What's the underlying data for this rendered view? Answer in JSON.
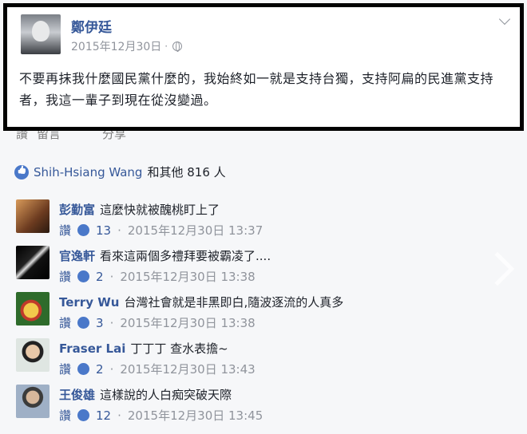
{
  "post": {
    "author": "鄭伊廷",
    "date": "2015年12月30日",
    "separator": "·",
    "body": "不要再抹我什麼國民黨什麼的，我始終如一就是支持台獨，支持阿扁的民進黨支持者，我這一輩子到現在從沒變過。"
  },
  "actions": {
    "like": "讚",
    "comment": "留言",
    "share": "分享"
  },
  "reactions": {
    "names": "Shih-Hsiang Wang",
    "others": "和其他 816 人"
  },
  "comments": [
    {
      "name": "彭勤富",
      "text": "這麼快就被醜桃盯上了",
      "reply": "讚",
      "likes": "13",
      "timestamp": "2015年12月30日 13:37",
      "avatar_color": "#6b3a1f"
    },
    {
      "name": "官逸軒",
      "text": "看來這兩個多禮拜要被霸凌了....",
      "reply": "讚",
      "likes": "2",
      "timestamp": "2015年12月30日 13:38",
      "avatar_color": "#111111"
    },
    {
      "name": "Terry Wu",
      "text": "台灣社會就是非黑即白,隨波逐流的人真多",
      "reply": "讚",
      "likes": "3",
      "timestamp": "2015年12月30日 13:38",
      "avatar_color": "#2e6b2b"
    },
    {
      "name": "Fraser Lai",
      "text": "丁丁丁 查水表擔~",
      "reply": "讚",
      "likes": "2",
      "timestamp": "2015年12月30日 13:43",
      "avatar_color": "#3d4a44"
    },
    {
      "name": "王俊雄",
      "text": "這樣說的人白痴突破天際",
      "reply": "讚",
      "likes": "12",
      "timestamp": "2015年12月30日 13:45",
      "avatar_color": "#5b6d86"
    }
  ],
  "icons": {
    "globe": "globe-icon",
    "chevron": "chevron-down-icon",
    "like": "like-icon",
    "next": "chevron-right-icon"
  },
  "colors": {
    "link": "#365899",
    "meta": "#90949c",
    "like_badge": "#4a78c9",
    "frame": "#000000"
  }
}
